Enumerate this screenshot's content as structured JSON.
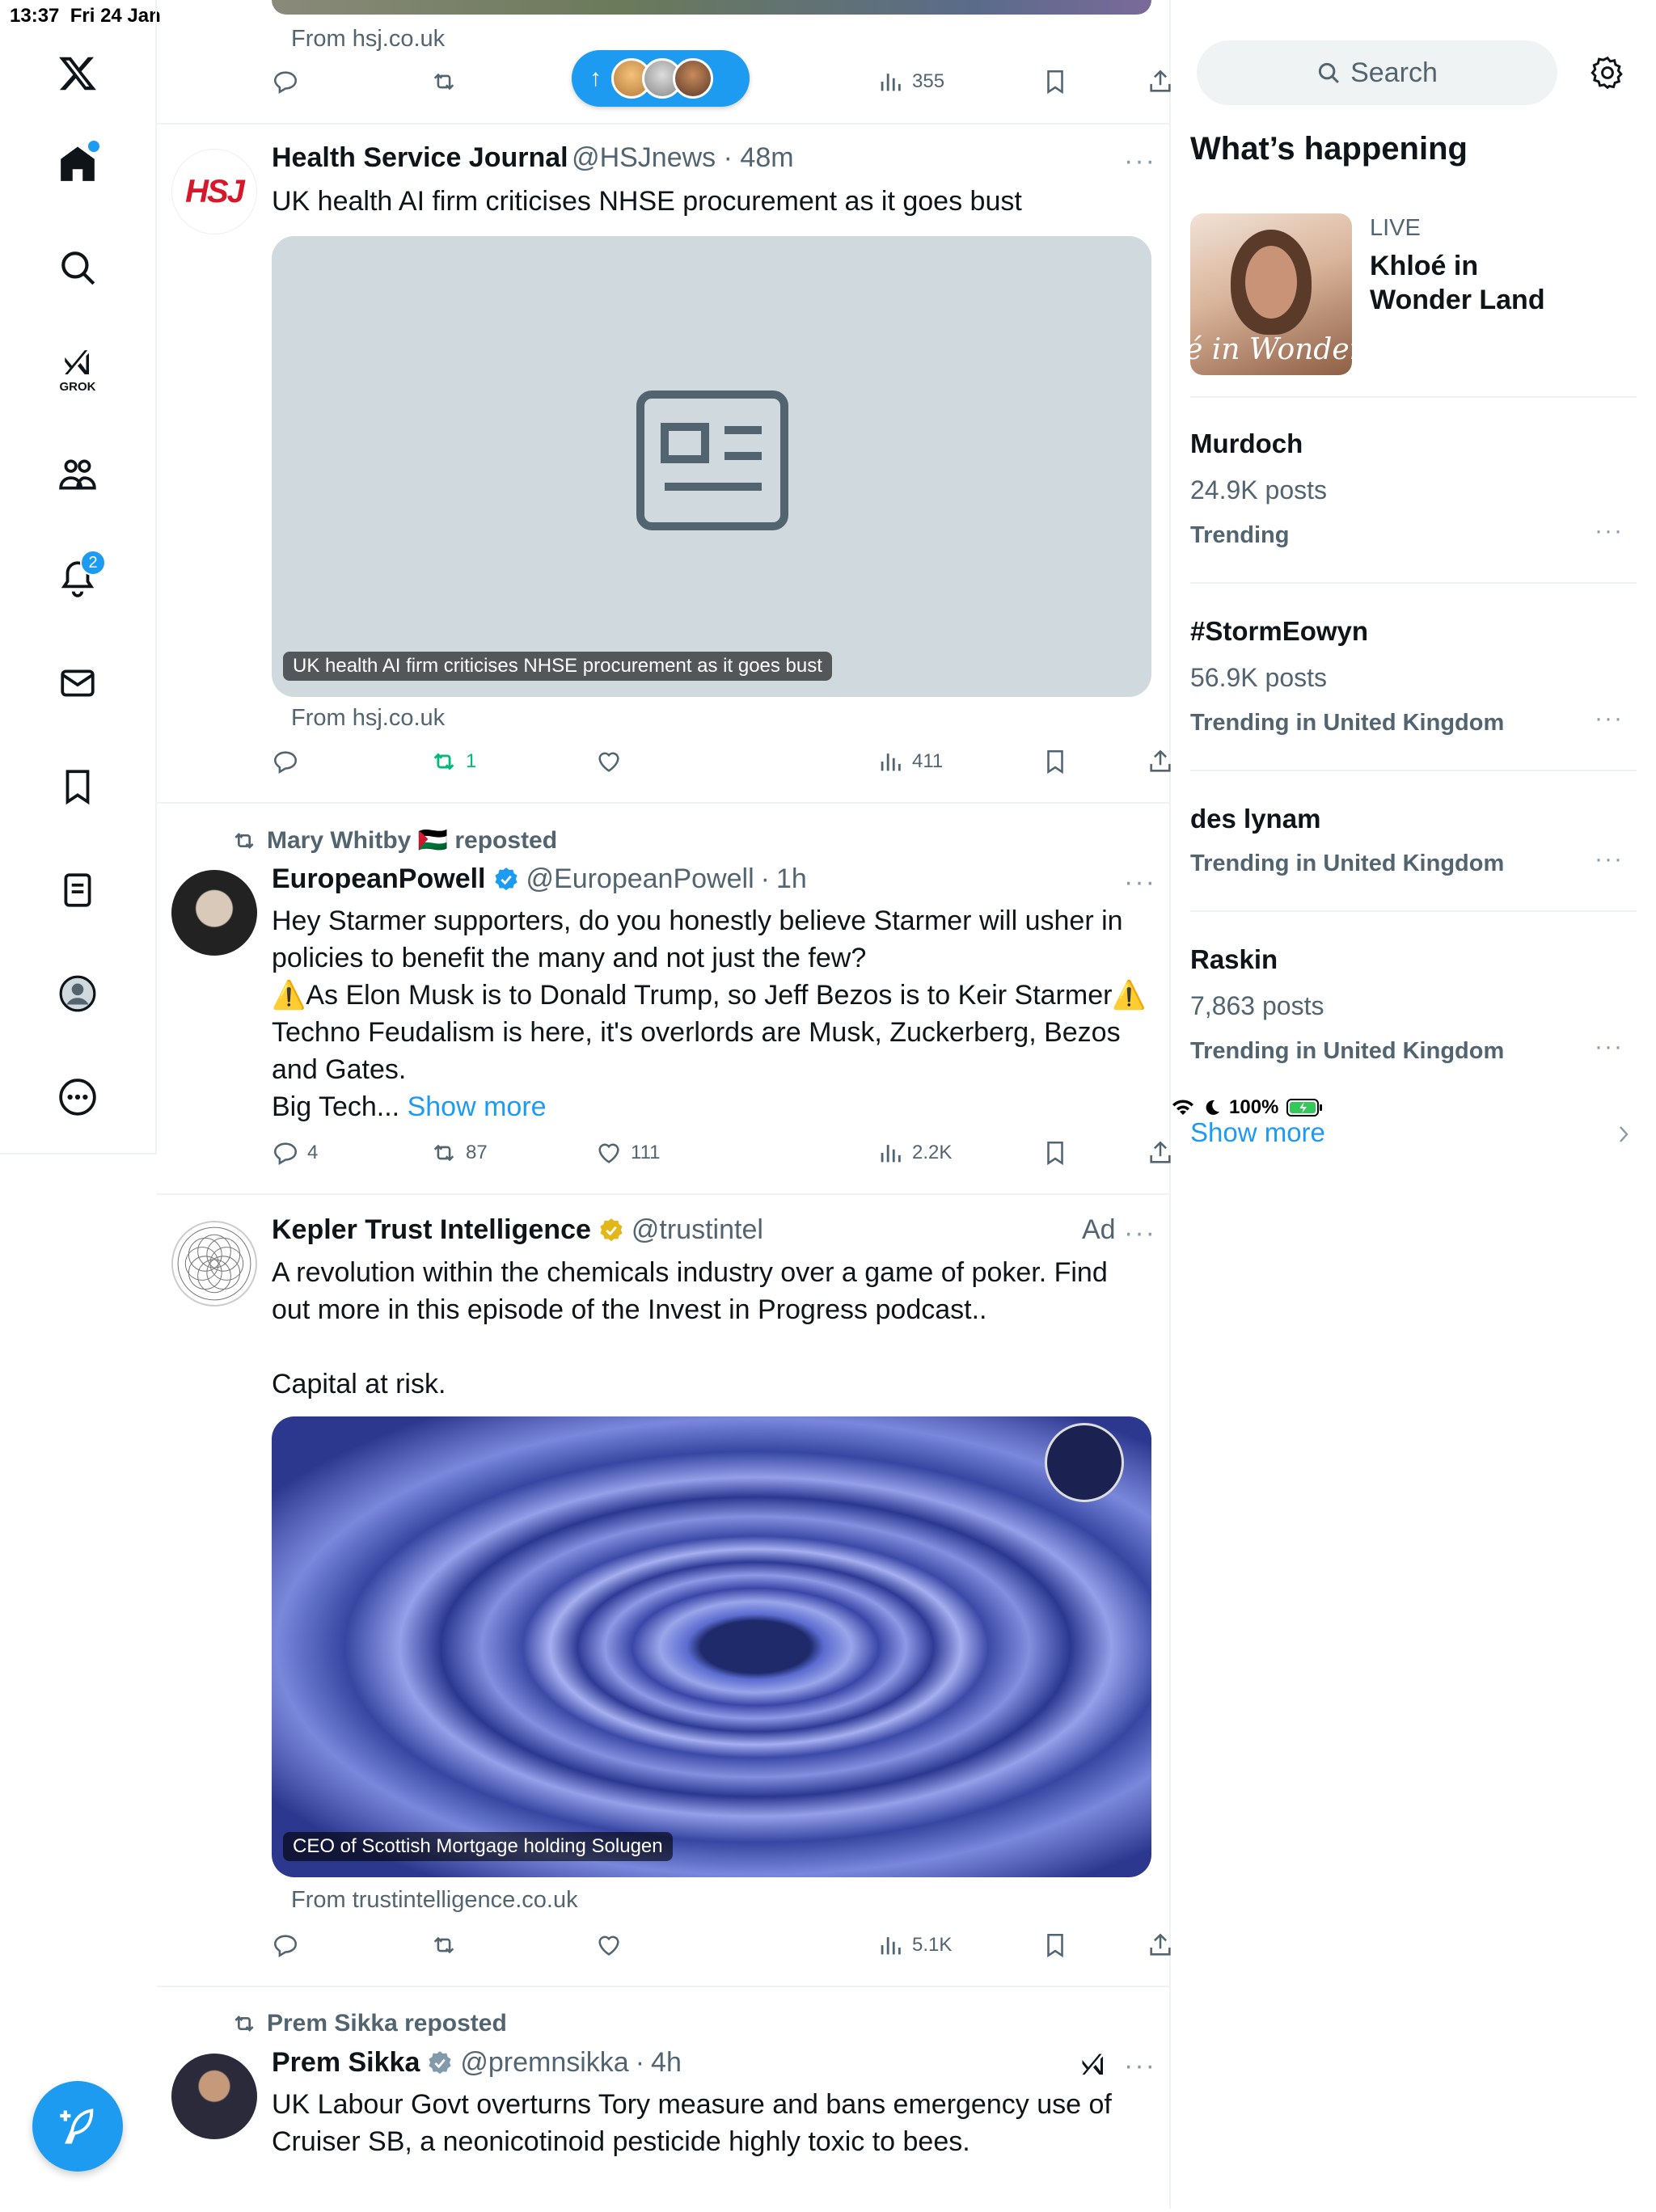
{
  "status": {
    "time": "13:37",
    "date": "Fri 24 Jan",
    "battery": "100%"
  },
  "sidebar": {
    "items": [
      "home",
      "explore",
      "grok",
      "communities",
      "notifications",
      "messages",
      "bookmarks",
      "lists",
      "profile",
      "more"
    ],
    "grok_label": "GROK",
    "notifications_count": "2"
  },
  "pill": {
    "arrow": "↑"
  },
  "posts": [
    {
      "id": "top-partial",
      "from": "From hsj.co.uk",
      "views": "355"
    },
    {
      "id": "hsj",
      "name": "Health Service Journal",
      "handle": "@HSJnews",
      "time": "48m",
      "text": "UK health AI firm criticises NHSE procurement as it goes bust",
      "caption": "UK health AI firm criticises NHSE procurement as it goes bust",
      "from": "From hsj.co.uk",
      "reposts": "1",
      "views": "411"
    },
    {
      "id": "europeanpowell",
      "repost_by": "Mary Whitby 🇵🇸 reposted",
      "name": "EuropeanPowell",
      "handle": "@EuropeanPowell",
      "time": "1h",
      "lines": [
        "Hey Starmer supporters, do you honestly believe Starmer will usher in",
        "policies to benefit the many and not just the few?",
        "⚠️As Elon Musk is to Donald Trump, so Jeff Bezos is to Keir Starmer⚠️",
        "Techno Feudalism is here, it's overlords are Musk, Zuckerberg, Bezos",
        "and Gates.",
        "Big Tech..."
      ],
      "show_more": "Show more",
      "replies": "4",
      "reposts": "87",
      "likes": "111",
      "views": "2.2K"
    },
    {
      "id": "kepler",
      "name": "Kepler Trust Intelligence",
      "handle": "@trustintel",
      "ad": "Ad",
      "lines": [
        "A revolution within the chemicals industry over a game of poker. Find",
        "out more in this episode of the Invest in Progress podcast..",
        "",
        "Capital at risk."
      ],
      "caption": "CEO of Scottish Mortgage holding Solugen",
      "from": "From trustintelligence.co.uk",
      "views": "5.1K"
    },
    {
      "id": "premsikka",
      "repost_by": "Prem Sikka reposted",
      "name": "Prem Sikka",
      "handle": "@premnsikka",
      "time": "4h",
      "lines": [
        "UK Labour Govt overturns Tory measure and bans emergency use of",
        "Cruiser SB, a neonicotinoid pesticide highly toxic to bees."
      ]
    }
  ],
  "right": {
    "search_placeholder": "Search",
    "heading": "What’s happening",
    "live": {
      "tag": "LIVE",
      "title_1": "Khloé in",
      "title_2": "Wonder Land",
      "image_text": "é in Wonder L"
    },
    "trends": [
      {
        "name": "Murdoch",
        "posts": "24.9K posts",
        "meta": "Trending"
      },
      {
        "name": "#StormEowyn",
        "posts": "56.9K posts",
        "meta": "Trending in United Kingdom"
      },
      {
        "name": "des lynam",
        "posts": "",
        "meta": "Trending in United Kingdom"
      },
      {
        "name": "Raskin",
        "posts": "7,863 posts",
        "meta": "Trending in United Kingdom"
      }
    ],
    "show_more": "Show more"
  },
  "colors": {
    "accent": "#1d9bf0",
    "repost_green": "#00ba7c",
    "muted": "#536471",
    "verified_gold": "#e2b719"
  }
}
